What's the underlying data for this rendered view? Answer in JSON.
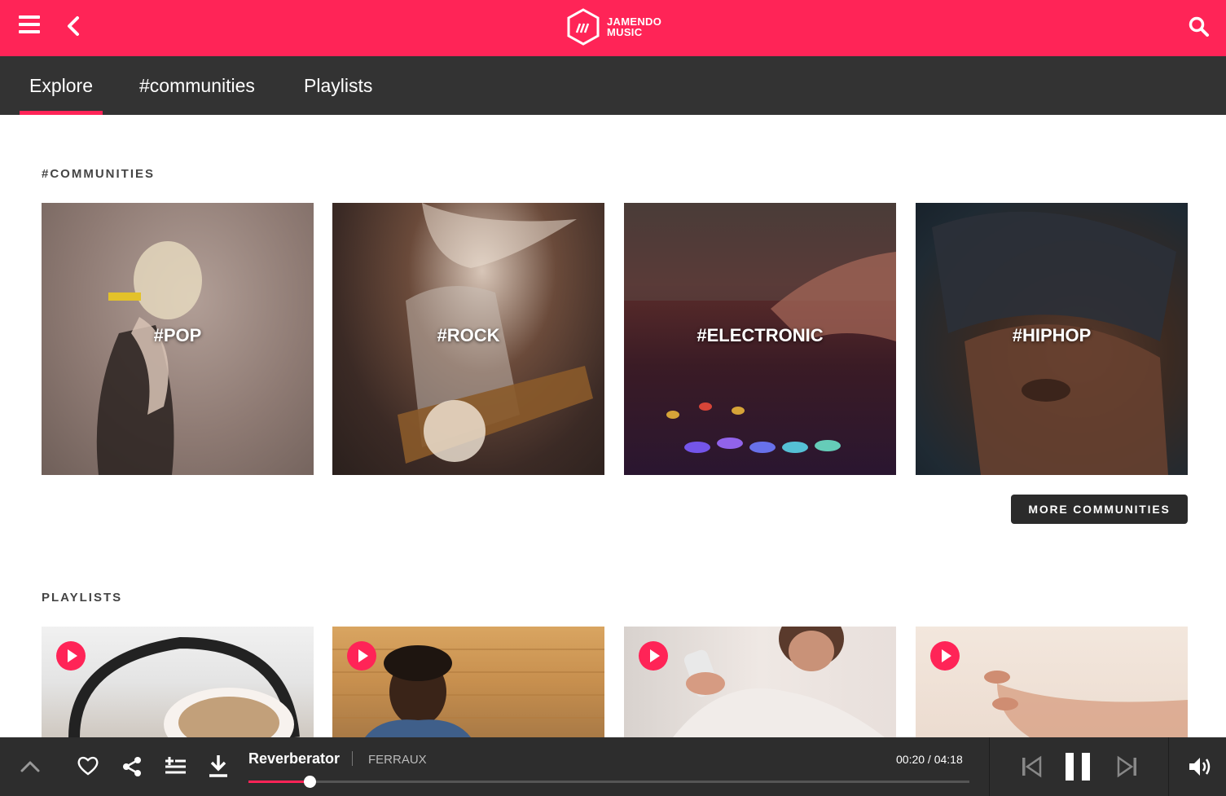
{
  "header": {
    "logo_line1": "JAMENDO",
    "logo_line2": "MUSIC",
    "menu_icon": "hamburger-icon",
    "back_icon": "chevron-left-icon",
    "search_icon": "search-icon",
    "accent_color": "#ff2457"
  },
  "tabs": [
    {
      "label": "Explore",
      "active": true
    },
    {
      "label": "#communities",
      "active": false
    },
    {
      "label": "Playlists",
      "active": false
    }
  ],
  "communities": {
    "title": "#COMMUNITIES",
    "cards": [
      {
        "label": "#POP"
      },
      {
        "label": "#ROCK"
      },
      {
        "label": "#ELECTRONIC"
      },
      {
        "label": "#HIPHOP"
      }
    ],
    "more_label": "MORE COMMUNITIES"
  },
  "playlists": {
    "title": "PLAYLISTS",
    "play_icon": "play-icon"
  },
  "player": {
    "track_title": "Reverberator",
    "artist": "FERRAUX",
    "time_current": "00:20",
    "time_total": "04:18",
    "time_display": "00:20 / 04:18",
    "progress": 0.085,
    "icons": [
      "chevron-up-icon",
      "heart-icon",
      "share-icon",
      "playlist-add-icon",
      "download-icon",
      "skip-previous-icon",
      "pause-icon",
      "skip-next-icon",
      "volume-icon"
    ]
  }
}
